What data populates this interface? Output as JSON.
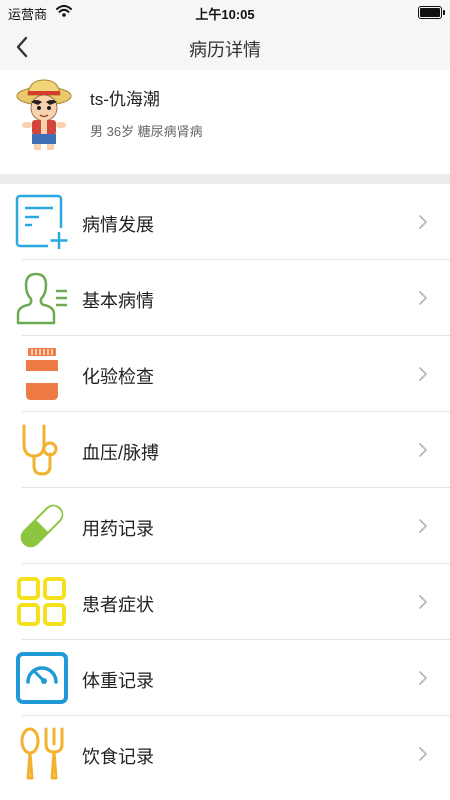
{
  "status_bar": {
    "carrier": "运营商",
    "time": "上午10:05"
  },
  "nav": {
    "title": "病历详情"
  },
  "patient": {
    "name": "ts-仇海潮",
    "info": "男 36岁 糖尿病肾病"
  },
  "menu": [
    {
      "label": "病情发展",
      "icon": "record-add-icon",
      "color": "#2aa8e0"
    },
    {
      "label": "基本病情",
      "icon": "person-list-icon",
      "color": "#6cab52"
    },
    {
      "label": "化验检查",
      "icon": "pill-bottle-icon",
      "color": "#ee7a44"
    },
    {
      "label": "血压/脉搏",
      "icon": "stethoscope-icon",
      "color": "#f2b12e"
    },
    {
      "label": "用药记录",
      "icon": "capsule-icon",
      "color": "#8cc63f"
    },
    {
      "label": "患者症状",
      "icon": "grid-icon",
      "color": "#f4e01c"
    },
    {
      "label": "体重记录",
      "icon": "scale-icon",
      "color": "#1f9ad6"
    },
    {
      "label": "饮食记录",
      "icon": "utensils-icon",
      "color": "#f2b12e"
    }
  ]
}
